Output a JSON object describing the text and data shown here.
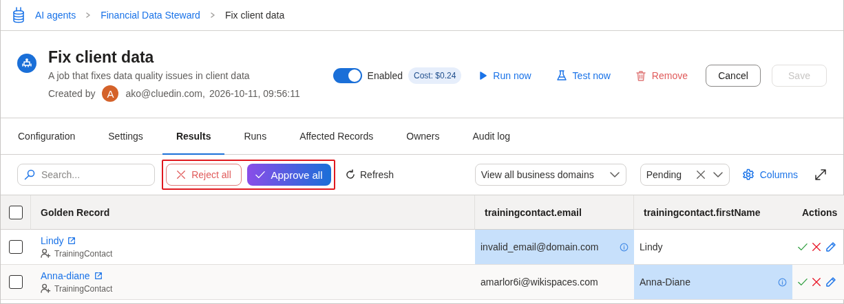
{
  "breadcrumbs": [
    {
      "label": "AI agents",
      "kind": "link"
    },
    {
      "label": "Financial Data Steward",
      "kind": "link"
    },
    {
      "label": "Fix client data",
      "kind": "current"
    }
  ],
  "header": {
    "title": "Fix client data",
    "description": "A job that fixes data quality issues in client data",
    "created_by_label": "Created by",
    "avatar_letter": "A",
    "creator": "ako@cluedin.com,",
    "created_at": "2026-10-11, 09:56:11"
  },
  "actions": {
    "enabled": {
      "label": "Enabled",
      "on": true
    },
    "cost": "Cost: $0.24",
    "buttons": [
      {
        "label": "Run now",
        "kind": "run",
        "disabled": false
      },
      {
        "label": "Test now",
        "kind": "test",
        "disabled": false
      },
      {
        "label": "Remove",
        "kind": "remove",
        "disabled": false
      },
      {
        "label": "Cancel",
        "kind": "cancel",
        "disabled": false
      },
      {
        "label": "Save",
        "kind": "save",
        "disabled": true
      }
    ]
  },
  "tabs": [
    {
      "label": "Configuration",
      "selected": false
    },
    {
      "label": "Settings",
      "selected": false
    },
    {
      "label": "Results",
      "selected": true
    },
    {
      "label": "Runs",
      "selected": false
    },
    {
      "label": "Affected Records",
      "selected": false
    },
    {
      "label": "Owners",
      "selected": false
    },
    {
      "label": "Audit log",
      "selected": false
    }
  ],
  "toolbar": {
    "search": {
      "placeholder": "Search..."
    },
    "reject_all": "Reject all",
    "approve_all": "Approve all",
    "refresh": "Refresh",
    "domain_select": "View all business domains",
    "status_select": "Pending",
    "columns": "Columns"
  },
  "table": {
    "select_all": {
      "checked": false
    },
    "columns": [
      "Golden Record",
      "trainingcontact.email",
      "trainingcontact.firstName",
      "Actions"
    ],
    "rows": [
      {
        "checked": false,
        "name": "Lindy",
        "entity_type": "TrainingContact",
        "email": "invalid_email@domain.com",
        "email_flagged": true,
        "first_name": "Lindy",
        "first_name_flagged": false
      },
      {
        "checked": false,
        "name": "Anna-diane",
        "entity_type": "TrainingContact",
        "email": "amarlor6i@wikispaces.com",
        "email_flagged": false,
        "first_name": "Anna-Diane",
        "first_name_flagged": true
      }
    ]
  }
}
